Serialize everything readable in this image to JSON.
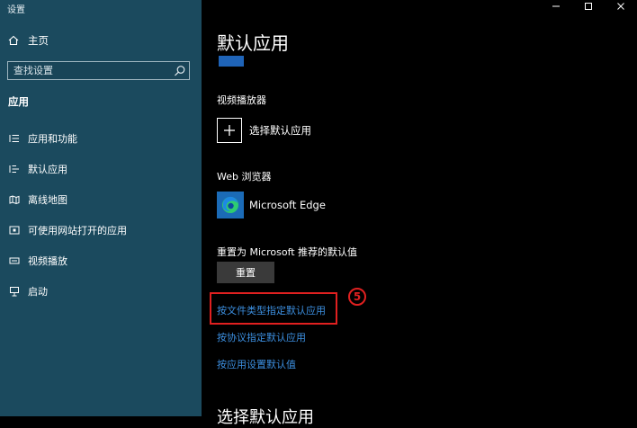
{
  "window": {
    "title": "设置"
  },
  "sidebar": {
    "home_label": "主页",
    "search_placeholder": "查找设置",
    "section_title": "应用",
    "items": [
      {
        "label": "应用和功能",
        "icon": "apps-list-icon"
      },
      {
        "label": "默认应用",
        "icon": "default-apps-icon"
      },
      {
        "label": "离线地图",
        "icon": "offline-map-icon"
      },
      {
        "label": "可使用网站打开的应用",
        "icon": "website-apps-icon"
      },
      {
        "label": "视频播放",
        "icon": "video-playback-icon"
      },
      {
        "label": "启动",
        "icon": "startup-icon"
      }
    ]
  },
  "main": {
    "title": "默认应用",
    "video_player": {
      "label": "视频播放器",
      "app_label": "选择默认应用"
    },
    "web_browser": {
      "label": "Web 浏览器",
      "app_label": "Microsoft Edge"
    },
    "reset": {
      "label": "重置为 Microsoft 推荐的默认值",
      "button": "重置"
    },
    "links": [
      "按文件类型指定默认应用",
      "按协议指定默认应用",
      "按应用设置默认值"
    ],
    "bottom_heading": "选择默认应用"
  },
  "annotation": {
    "step": "5",
    "color": "#e02020"
  },
  "colors": {
    "sidebar_bg": "#1b4a5e",
    "link": "#3c8fe0",
    "edge_icon": "#1b6bb7"
  }
}
